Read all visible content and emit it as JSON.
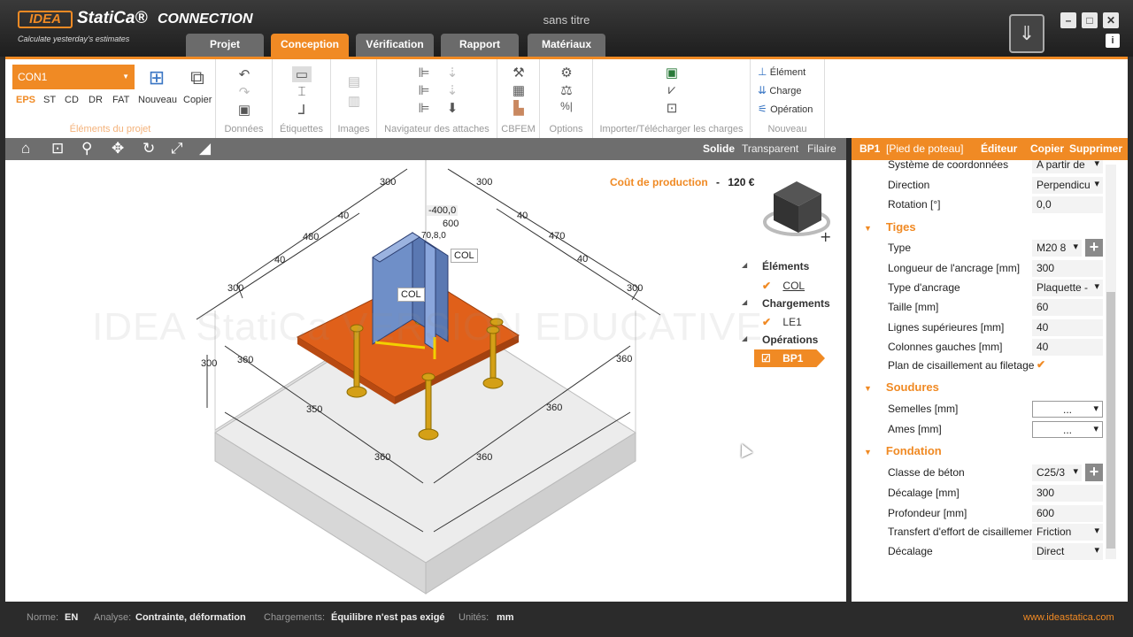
{
  "app": {
    "logo": "IDEA",
    "brand": "StatiCa®",
    "product": "CONNECTION",
    "tagline": "Calculate yesterday's estimates",
    "document_title": "sans titre"
  },
  "tabs": [
    {
      "label": "Projet"
    },
    {
      "label": "Conception",
      "active": true
    },
    {
      "label": "Vérification"
    },
    {
      "label": "Rapport"
    },
    {
      "label": "Matériaux"
    }
  ],
  "ribbon": {
    "connection_select": "CON1",
    "connection_types": [
      "EPS",
      "ST",
      "CD",
      "DR",
      "FAT"
    ],
    "nouveau_label": "Nouveau",
    "copier_label": "Copier",
    "groups": {
      "elements_projet": "Éléments du projet",
      "donnees": "Données",
      "etiquettes": "Étiquettes",
      "images": "Images",
      "navigateur": "Navigateur des attaches",
      "cbfem": "CBFEM",
      "options": "Options",
      "import": "Importer/Télécharger les charges",
      "nouveau": "Nouveau"
    },
    "new_items": [
      "Élément",
      "Charge",
      "Opération"
    ]
  },
  "view_toolbar": {
    "modes": [
      "Solide",
      "Transparent",
      "Filaire"
    ],
    "active_mode": "Solide"
  },
  "viewport": {
    "cost_label": "Coût de production",
    "cost_sep": "-",
    "cost_value": "120 €",
    "watermark": "IDEA StatiCa VERSION EDUCATIVE",
    "dims": {
      "d300": "300",
      "d40": "40",
      "d480": "480",
      "d470": "470",
      "d400": "-400,0",
      "d600": "600",
      "d360": "360",
      "d350": "350",
      "d708": "70,8,0"
    },
    "labels": {
      "col": "COL"
    },
    "tree": {
      "elements_header": "Éléments",
      "elements": [
        "COL"
      ],
      "loads_header": "Chargements",
      "loads": [
        "LE1"
      ],
      "ops_header": "Opérations",
      "ops": [
        "BP1"
      ]
    }
  },
  "properties": {
    "header": {
      "item": "BP1",
      "desc": "[Pied de poteau]",
      "editor": "Éditeur",
      "copy": "Copier",
      "delete": "Supprimer"
    },
    "rows_top": [
      {
        "label": "Système de coordonnées",
        "value": "A partir de"
      },
      {
        "label": "Direction",
        "value": "Perpendicu"
      },
      {
        "label": "Rotation [°]",
        "value": "0,0"
      }
    ],
    "tiges": {
      "title": "Tiges",
      "rows": [
        {
          "label": "Type",
          "value": "M20 8"
        },
        {
          "label": "Longueur de l'ancrage [mm]",
          "value": "300"
        },
        {
          "label": "Type d'ancrage",
          "value": "Plaquette -"
        },
        {
          "label": "Taille [mm]",
          "value": "60"
        },
        {
          "label": "Lignes supérieures [mm]",
          "value": "40"
        },
        {
          "label": "Colonnes gauches [mm]",
          "value": "40"
        },
        {
          "label": "Plan de cisaillement au filetage",
          "value": "✔"
        }
      ]
    },
    "soudures": {
      "title": "Soudures",
      "rows": [
        {
          "label": "Semelles [mm]",
          "value": "..."
        },
        {
          "label": "Ames [mm]",
          "value": "..."
        }
      ]
    },
    "fondation": {
      "title": "Fondation",
      "rows": [
        {
          "label": "Classe de béton",
          "value": "C25/3"
        },
        {
          "label": "Décalage [mm]",
          "value": "300"
        },
        {
          "label": "Profondeur [mm]",
          "value": "600"
        },
        {
          "label": "Transfert d'effort de cisaillement",
          "value": "Friction"
        },
        {
          "label": "Décalage",
          "value": "Direct"
        }
      ]
    }
  },
  "status": {
    "norme_label": "Norme:",
    "norme": "EN",
    "analyse_label": "Analyse:",
    "analyse": "Contrainte, déformation",
    "charges_label": "Chargements:",
    "charges": "Équilibre n'est pas exigé",
    "unites_label": "Unités:",
    "unites": "mm",
    "website": "www.ideastatica.com"
  },
  "colors": {
    "accent": "#f08a24",
    "concrete": "#d9d9d9",
    "plate": "#e0601a",
    "column": "#6f8fc8",
    "bolt": "#d4a017"
  }
}
